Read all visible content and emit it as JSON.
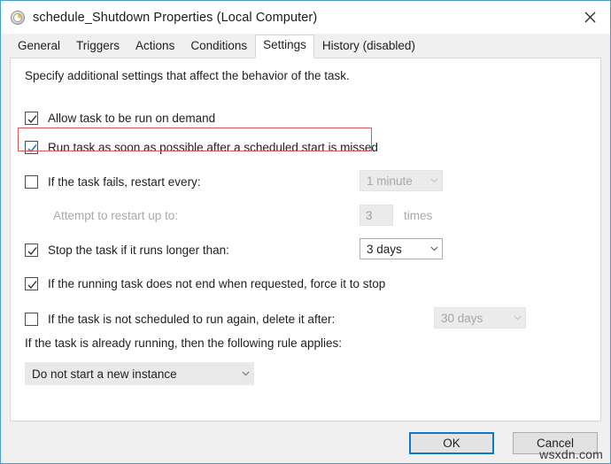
{
  "window": {
    "title": "schedule_Shutdown Properties (Local Computer)",
    "icon": "clock-icon",
    "close_label": "✕",
    "accent": "#0d7bc4",
    "highlight_color": "#d7595c"
  },
  "tabs": [
    {
      "label": "General",
      "active": false
    },
    {
      "label": "Triggers",
      "active": false
    },
    {
      "label": "Actions",
      "active": false
    },
    {
      "label": "Conditions",
      "active": false
    },
    {
      "label": "Settings",
      "active": true
    },
    {
      "label": "History (disabled)",
      "active": false
    }
  ],
  "settings": {
    "intro": "Specify additional settings that affect the behavior of the task.",
    "run_on_demand": {
      "label": "Allow task to be run on demand",
      "checked": true,
      "enabled": true
    },
    "run_asap_missed": {
      "label": "Run task as soon as possible after a scheduled start is missed",
      "checked": true,
      "enabled": true,
      "highlighted": true
    },
    "restart_on_fail": {
      "label": "If the task fails, restart every:",
      "checked": false,
      "enabled": true,
      "interval_value": "1 minute",
      "interval_enabled": false
    },
    "restart_attempts": {
      "label": "Attempt to restart up to:",
      "value": "3",
      "suffix": "times",
      "enabled": false
    },
    "stop_if_longer": {
      "label": "Stop the task if it runs longer than:",
      "checked": true,
      "enabled": true,
      "duration_value": "3 days",
      "duration_enabled": true
    },
    "force_stop": {
      "label": "If the running task does not end when requested, force it to stop",
      "checked": true,
      "enabled": true
    },
    "delete_if_not_scheduled": {
      "label": "If the task is not scheduled to run again, delete it after:",
      "checked": false,
      "enabled": true,
      "duration_value": "30 days",
      "duration_enabled": false
    },
    "already_running_label": "If the task is already running, then the following rule applies:",
    "already_running_rule": "Do not start a new instance"
  },
  "footer": {
    "ok_label": "OK",
    "cancel_label": "Cancel"
  },
  "watermark": "wsxdn.com"
}
